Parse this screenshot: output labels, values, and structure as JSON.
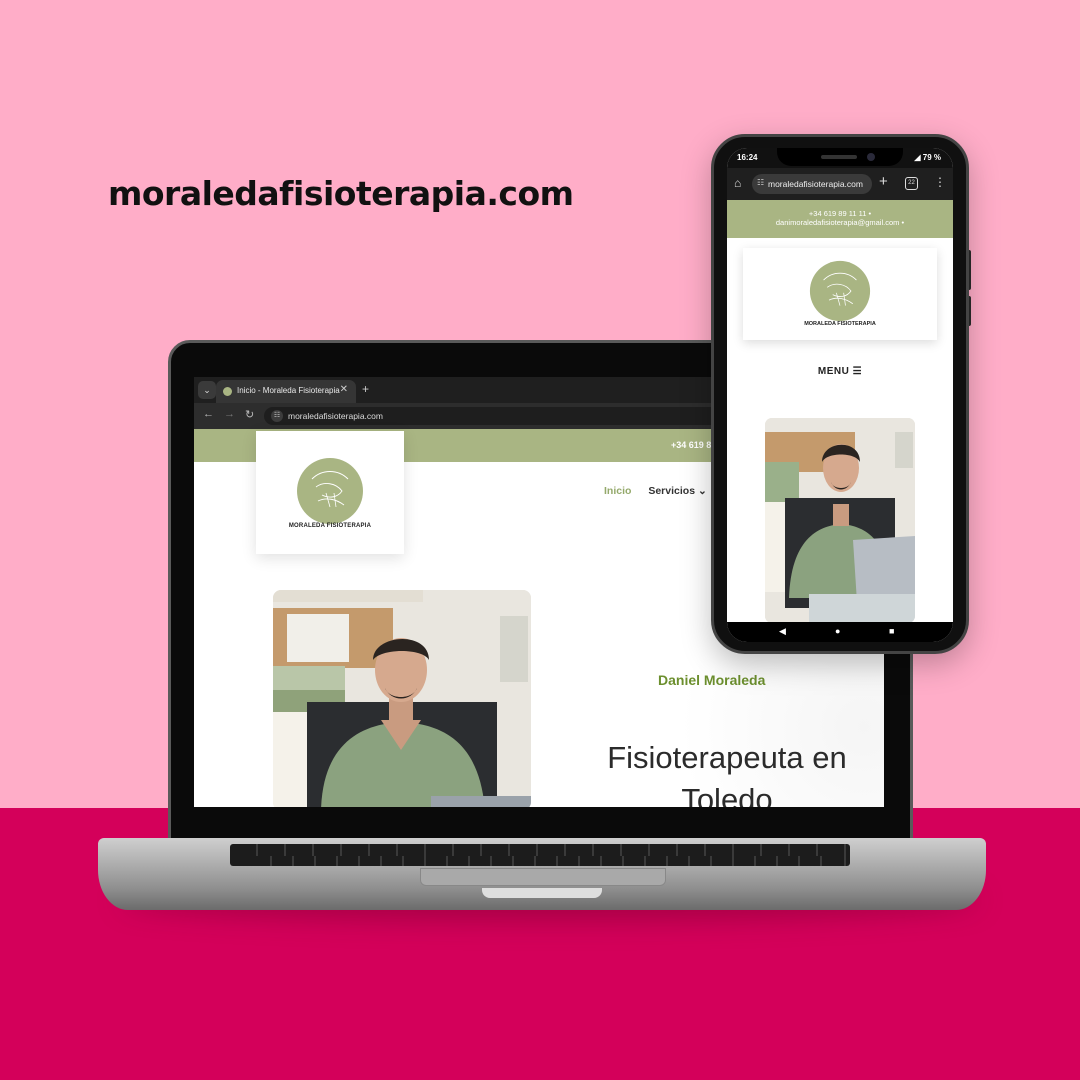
{
  "heading": "moraledafisioterapia.com",
  "colors": {
    "background_pink": "#ffadc8",
    "background_magenta": "#d4005a",
    "brand_green": "#a9b583",
    "accent_green": "#6c8f2e"
  },
  "laptop": {
    "tab_title": "Inicio - Moraleda Fisioterapia",
    "new_tab_symbol": "+",
    "address_url": "moraledafisioterapia.com",
    "topbar_phone": "+34 619 8",
    "logo_text": "MORALEDA FISIOTERAPIA",
    "nav": {
      "inicio": "Inicio",
      "servicios": "Servicios ⌄"
    },
    "hero_name": "Daniel Moraleda",
    "hero_title": "Fisioterapeuta en Toledo"
  },
  "phone": {
    "status_time": "16:24",
    "status_right": "◢ 79 %",
    "address_url": "moraledafisioterapia.com",
    "tab_count": "22",
    "topbar_phone": "+34 619 89 11 11 •",
    "topbar_email": "danimoraledafisioterapia@gmail.com •",
    "logo_text": "MORALEDA FISIOTERAPIA",
    "menu_label": "MENU ☰"
  }
}
